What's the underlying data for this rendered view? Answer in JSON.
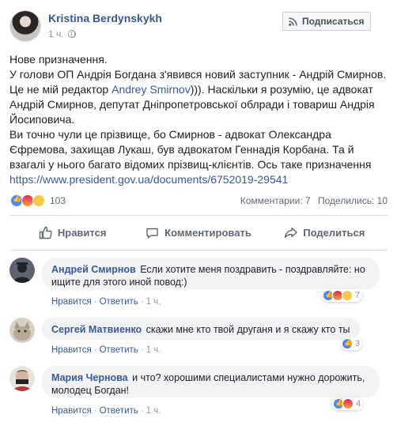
{
  "post": {
    "author": "Kristina Berdynskykh",
    "time": "1 ч.",
    "subscribe_label": "Подписаться",
    "text_line1": "Нове призначення.",
    "text_p2_a": "У голови ОП Андрія Богдана з'явився новий заступник - Андрій Смирнов. Це не мій редактор ",
    "text_p2_link": "Andrey Smirnov",
    "text_p2_b": "))). Наскільки я розумію, це адвокат Андрій Смирнов, депутат Дніпропетровської облради і товариш Андрія Йосиповича.",
    "text_p3": "Ви точно чули це прізвище, бо Смирнов - адвокат Олександра Єфремова, захищав Лукаш, був адвокатом Геннадія Корбана. Та й взагалі у нього багато відомих прізвищ-клієнтів. Ось таке призначення",
    "url": "https://www.president.gov.ua/documents/6752019-29541",
    "reaction_count": "103",
    "comments_label": "Комментарии: 7",
    "shares_label": "Поделились: 10"
  },
  "actions": {
    "like": "Нравится",
    "comment": "Комментировать",
    "share": "Поделиться"
  },
  "comments": [
    {
      "name": "Андрей Смирнов",
      "text": "Если хотите меня поздравить - поздравляйте: но ищите для этого иной повод:)",
      "like": "Нравится",
      "reply": "Ответить",
      "time": "1 ч.",
      "reactions": "7"
    },
    {
      "name": "Сергей Матвиенко",
      "text": "скажи мне кто твой друганя и я скажу кто ты",
      "like": "Нравится",
      "reply": "Ответить",
      "time": "1 ч.",
      "reactions": "3"
    },
    {
      "name": "Мария Чернова",
      "text": "и что? хорошими специалистами нужно дорожить, молодец Богдан!",
      "like": "Нравится",
      "reply": "Ответить",
      "time": "1 ч.",
      "reactions": "4"
    }
  ],
  "icons": {
    "globe": "globe-icon",
    "rss": "rss-icon",
    "like": "thumbs-up-icon",
    "comment": "speech-bubble-icon",
    "share": "share-arrow-icon"
  },
  "colors": {
    "link": "#385898",
    "meta": "#90949c",
    "bubble": "#f2f3f5"
  }
}
